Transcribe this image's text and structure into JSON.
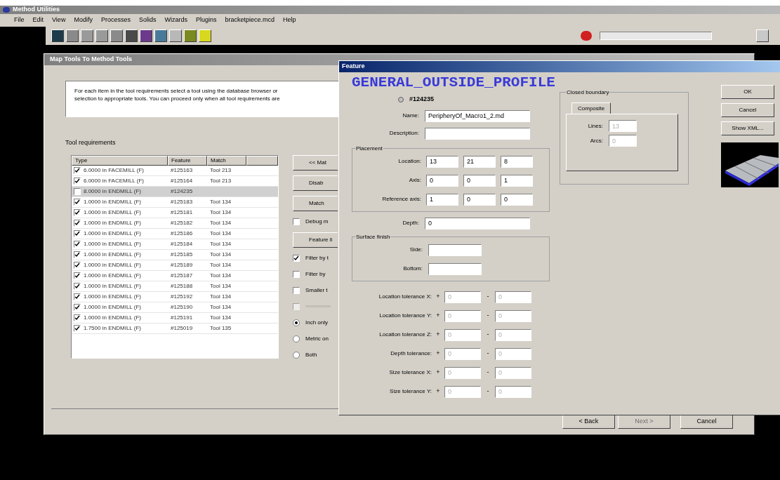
{
  "app": {
    "title": "Method Utilities",
    "menu": [
      "File",
      "Edit",
      "View",
      "Modify",
      "Processes",
      "Solids",
      "Wizards",
      "Plugins",
      "bracketpiece.mcd",
      "Help"
    ]
  },
  "wizard": {
    "title": "Map Tools To Method Tools",
    "instructions": [
      "For each item in the tool requirements select a tool using the database browser or",
      "selection to appropriate tools. You can proceed only when all tool requirements are"
    ],
    "list_label": "Tool requirements",
    "columns": [
      "Type",
      "Feature",
      "Match"
    ],
    "rows": [
      {
        "type": "6.0000 in FACEMILL (F)",
        "feature": "#125163",
        "match": "Tool 213",
        "checked": true,
        "selected": false
      },
      {
        "type": "6.0000 in FACEMILL (F)",
        "feature": "#125164",
        "match": "Tool 213",
        "checked": true,
        "selected": false
      },
      {
        "type": "8.0000 in ENDMILL (F)",
        "feature": "#124235",
        "match": "",
        "checked": false,
        "selected": true
      },
      {
        "type": "1.0000 in ENDMILL (F)",
        "feature": "#125183",
        "match": "Tool 134",
        "checked": true,
        "selected": false
      },
      {
        "type": "1.0000 in ENDMILL (F)",
        "feature": "#125181",
        "match": "Tool 134",
        "checked": true,
        "selected": false
      },
      {
        "type": "1.0000 in ENDMILL (F)",
        "feature": "#125182",
        "match": "Tool 134",
        "checked": true,
        "selected": false
      },
      {
        "type": "1.0000 in ENDMILL (F)",
        "feature": "#125186",
        "match": "Tool 134",
        "checked": true,
        "selected": false
      },
      {
        "type": "1.0000 in ENDMILL (F)",
        "feature": "#125184",
        "match": "Tool 134",
        "checked": true,
        "selected": false
      },
      {
        "type": "1.0000 in ENDMILL (F)",
        "feature": "#125185",
        "match": "Tool 134",
        "checked": true,
        "selected": false
      },
      {
        "type": "1.0000 in ENDMILL (F)",
        "feature": "#125189",
        "match": "Tool 134",
        "checked": true,
        "selected": false
      },
      {
        "type": "1.0000 in ENDMILL (F)",
        "feature": "#125187",
        "match": "Tool 134",
        "checked": true,
        "selected": false
      },
      {
        "type": "1.0000 in ENDMILL (F)",
        "feature": "#125188",
        "match": "Tool 134",
        "checked": true,
        "selected": false
      },
      {
        "type": "1.0000 in ENDMILL (F)",
        "feature": "#125192",
        "match": "Tool 134",
        "checked": true,
        "selected": false
      },
      {
        "type": "1.0000 in ENDMILL (F)",
        "feature": "#125190",
        "match": "Tool 134",
        "checked": true,
        "selected": false
      },
      {
        "type": "1.0000 in ENDMILL (F)",
        "feature": "#125191",
        "match": "Tool 134",
        "checked": true,
        "selected": false
      },
      {
        "type": "1.7500 in ENDMILL (F)",
        "feature": "#125019",
        "match": "Tool 135",
        "checked": true,
        "selected": false
      }
    ],
    "side": [
      {
        "kind": "button",
        "label": "<< Mat"
      },
      {
        "kind": "button",
        "label": "Disab"
      },
      {
        "kind": "button",
        "label": "Match"
      },
      {
        "kind": "checkbox",
        "label": "Debug m",
        "checked": false
      },
      {
        "kind": "button",
        "label": "Feature li"
      },
      {
        "kind": "checkbox",
        "label": "Filter by t",
        "checked": true
      },
      {
        "kind": "checkbox",
        "label": "Filter by",
        "checked": false
      },
      {
        "kind": "checkbox",
        "label": "Smaller t",
        "checked": false
      },
      {
        "kind": "checkbox",
        "checked": false,
        "disabled": true
      },
      {
        "kind": "radio",
        "label": "Inch only",
        "selected": true
      },
      {
        "kind": "radio",
        "label": "Metric on",
        "selected": false
      },
      {
        "kind": "radio",
        "label": "Both",
        "selected": false
      }
    ],
    "footer": [
      {
        "label": "< Back",
        "disabled": false
      },
      {
        "label": "Next >",
        "disabled": true
      },
      {
        "label": "Cancel",
        "disabled": false
      }
    ]
  },
  "feature": {
    "title": "Feature",
    "heading": "GENERAL_OUTSIDE_PROFILE",
    "id": "#124235",
    "name_label": "Name:",
    "name": "PeripheryOf_Macro1_2.md",
    "description_label": "Description:",
    "placement": {
      "title": "Placement",
      "rows": [
        {
          "label": "Location:",
          "values": [
            "13",
            "21",
            "8"
          ]
        },
        {
          "label": "Axis:",
          "values": [
            "0",
            "0",
            "1"
          ]
        },
        {
          "label": "Reference axis:",
          "values": [
            "1",
            "0",
            "0"
          ]
        }
      ]
    },
    "depth_label": "Depth:",
    "depth": "0",
    "finish": {
      "title": "Surface finish",
      "rows": [
        {
          "label": "Side:",
          "value": ""
        },
        {
          "label": "Bottom:",
          "value": ""
        }
      ]
    },
    "tolerances": [
      {
        "label": "Location tolerance X:",
        "plus": "+",
        "minus": "-",
        "values": [
          "0",
          "0"
        ]
      },
      {
        "label": "Location tolerance Y:",
        "plus": "+",
        "minus": "-",
        "values": [
          "0",
          "0"
        ]
      },
      {
        "label": "Location tolerance Z:",
        "plus": "+",
        "minus": "-",
        "values": [
          "0",
          "0"
        ]
      },
      {
        "label": "Depth tolerance:",
        "plus": "+",
        "minus": "-",
        "values": [
          "0",
          "0"
        ]
      },
      {
        "label": "Size tolerance X:",
        "plus": "+",
        "minus": "-",
        "values": [
          "0",
          "0"
        ]
      },
      {
        "label": "Size tolerance Y:",
        "plus": "+",
        "minus": "-",
        "values": [
          "0",
          "0"
        ]
      }
    ],
    "boundary": {
      "title": "Closed boundary",
      "tab": "Composite",
      "rows": [
        {
          "label": "Lines:",
          "value": "13"
        },
        {
          "label": "Arcs:",
          "value": "0"
        }
      ]
    },
    "buttons": [
      "OK",
      "Cancel",
      "Show XML..."
    ]
  }
}
